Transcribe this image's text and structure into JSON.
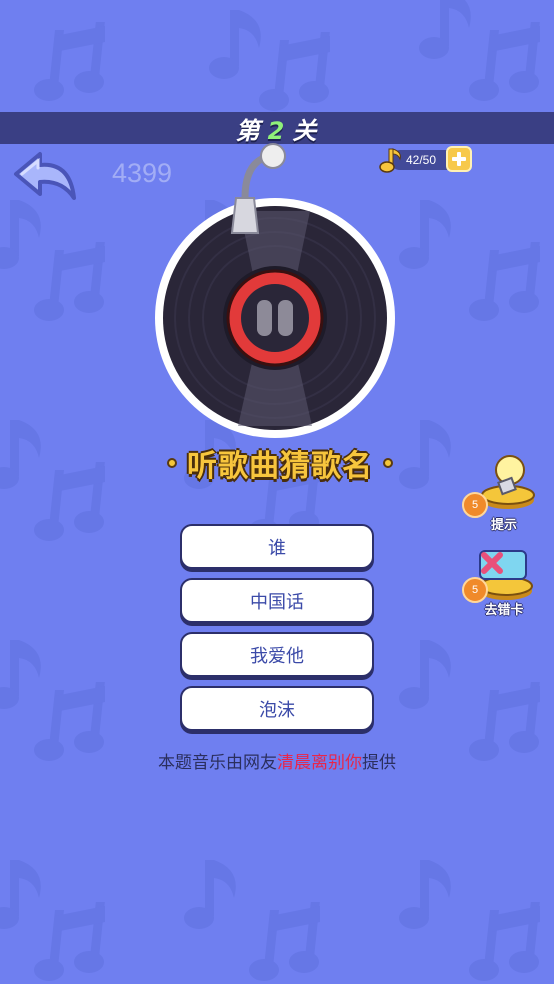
{
  "header": {
    "level_prefix": "第",
    "level_number": "2",
    "level_suffix": "关"
  },
  "watermark": "4399",
  "coins": {
    "text": "42/50"
  },
  "title": "听歌曲猜歌名",
  "hint": {
    "label": "提示",
    "cost": "5"
  },
  "remove_wrong": {
    "label": "去错卡",
    "cost": "5"
  },
  "options": [
    "谁",
    "中国话",
    "我爱他",
    "泡沫"
  ],
  "credit": {
    "prefix": "本题音乐由网友",
    "author": "清晨离别你",
    "suffix": "提供"
  },
  "colors": {
    "background": "#6f7ff0",
    "level_bar": "#3a3f84",
    "accent_yellow": "#f7c53d",
    "author_red": "#e8264a"
  }
}
